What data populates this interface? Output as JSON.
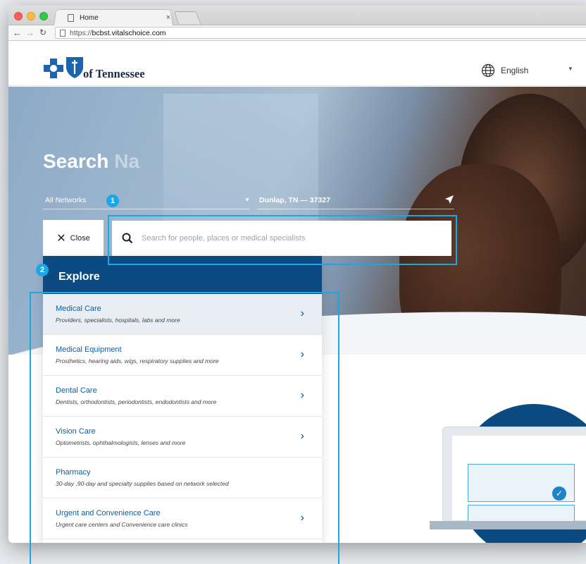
{
  "browser": {
    "tab_title": "Home",
    "tab_close": "×",
    "url_scheme": "https://",
    "url_host": "bcbst.vitalschoice.com"
  },
  "header": {
    "logo_text": "of Tennessee",
    "language_label": "English",
    "language_caret": "▼"
  },
  "hero": {
    "search_title": "Search",
    "search_title_faded": "Na",
    "network_label": "All Networks",
    "network_caret": "▼",
    "location_label": "Dunlap, TN — 37327",
    "close_label": "Close",
    "search_placeholder": "Search for people, places or medical specialists"
  },
  "explore": {
    "title": "Explore",
    "items": [
      {
        "title": "Medical Care",
        "subtitle": "Providers, specialists, hospitals, labs and more",
        "chevron": "›"
      },
      {
        "title": "Medical Equipment",
        "subtitle": "Prosthetics, hearing aids, wigs, respiratory supplies and more",
        "chevron": "›"
      },
      {
        "title": "Dental Care",
        "subtitle": "Dentists, orthodontists, periodontists, endodontists and more",
        "chevron": "›"
      },
      {
        "title": "Vision Care",
        "subtitle": "Optometrists, ophthalmologists, lenses and more",
        "chevron": "›"
      },
      {
        "title": "Pharmacy",
        "subtitle": "30-day ,90-day and specialty supplies based on network selected",
        "chevron": ""
      },
      {
        "title": "Urgent and Convenience Care",
        "subtitle": "Urgent care centers and Convenience care clinics",
        "chevron": "›"
      }
    ]
  },
  "annotations": {
    "badge_1": "1",
    "badge_2": "2"
  },
  "colors": {
    "brand_navy": "#0c4b82",
    "link_blue": "#0b5ea8",
    "callout_cyan": "#1aa7e6"
  }
}
